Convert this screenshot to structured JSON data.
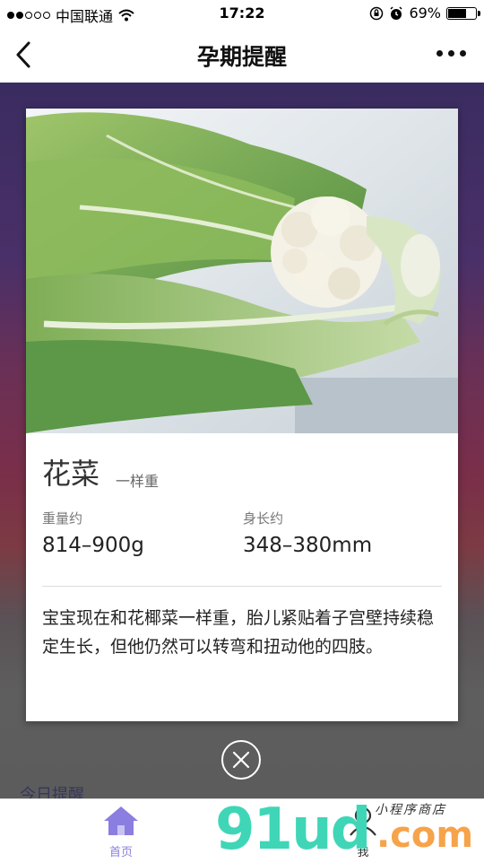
{
  "status_bar": {
    "carrier": "中国联通",
    "time": "17:22",
    "battery_percent": "69%",
    "battery_level": 0.69
  },
  "nav": {
    "title": "孕期提醒"
  },
  "background": {
    "section_title": "今日提醒"
  },
  "card": {
    "name": "花菜",
    "subtitle": "一样重",
    "weight_label": "重量约",
    "weight_value": "814–900g",
    "length_label": "身长约",
    "length_value": "348–380mm",
    "description": "宝宝现在和花椰菜一样重，胎儿紧贴着子宫壁持续稳定生长，但他仍然可以转弯和扭动他的四肢。"
  },
  "tabbar": {
    "home_label": "首页",
    "me_label": "我"
  },
  "watermark": {
    "brand": "91ud",
    "suffix": ".com",
    "tagline": "小程序商店"
  },
  "colors": {
    "accent": "#8a7ee0",
    "watermark_green": "#3fd6b7",
    "watermark_orange": "#f6a34a"
  }
}
